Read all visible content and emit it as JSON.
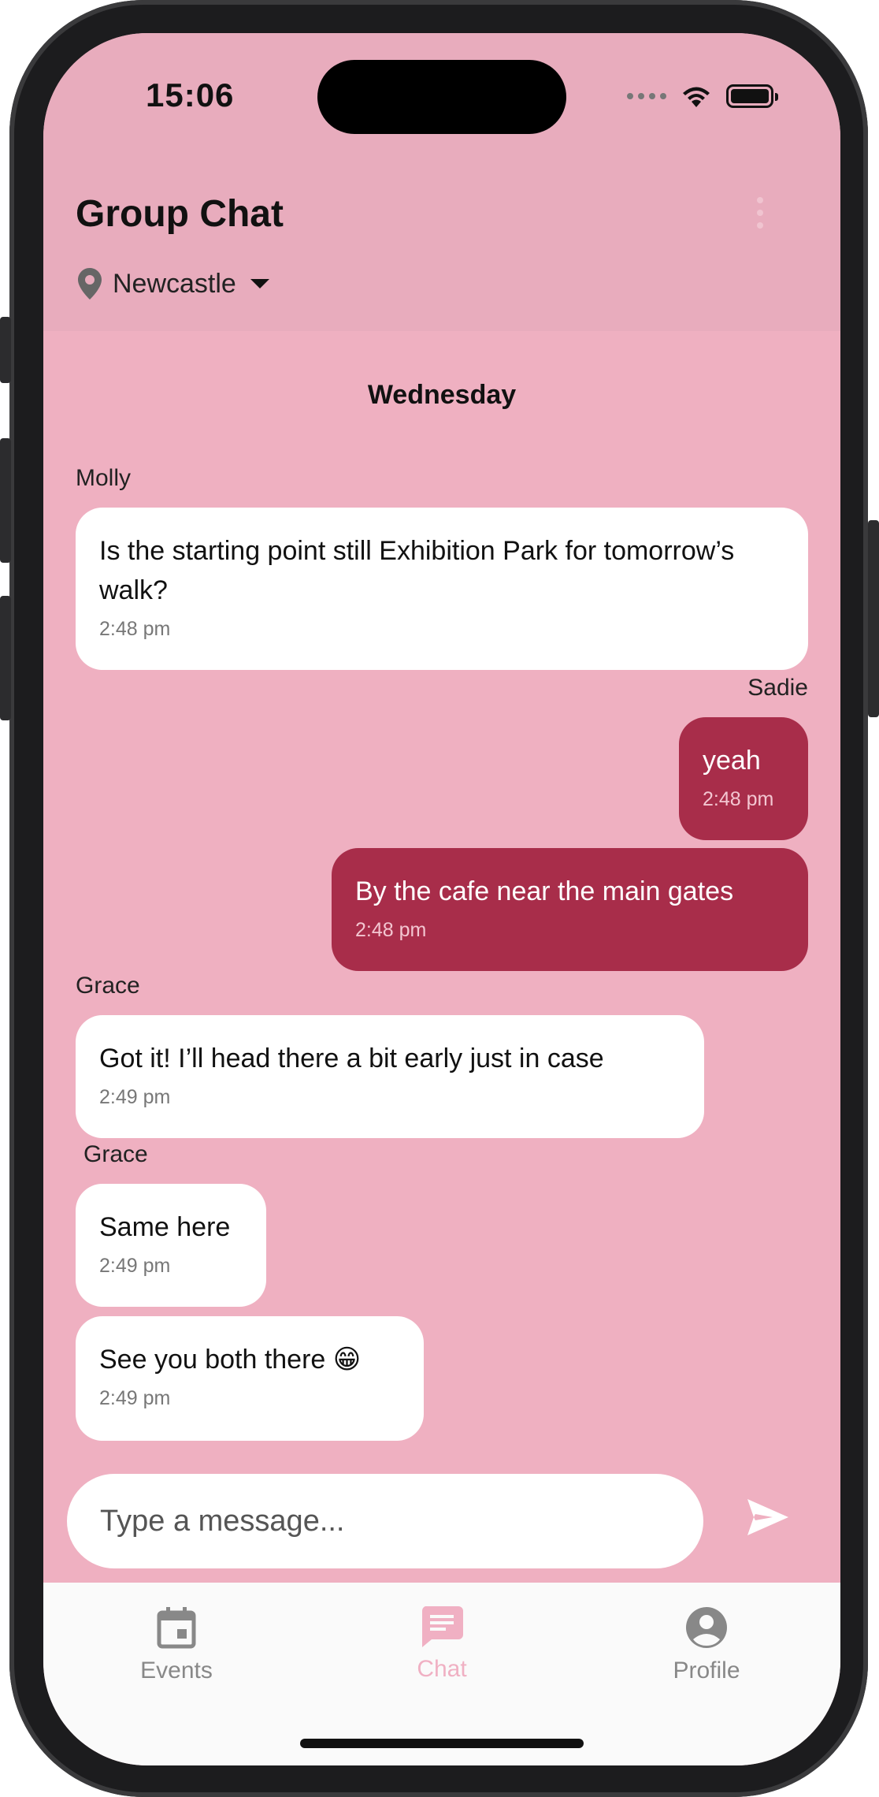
{
  "status_bar": {
    "time": "15:06"
  },
  "header": {
    "title": "Group Chat",
    "location": "Newcastle"
  },
  "chat": {
    "day_label": "Wednesday",
    "messages": [
      {
        "sender": "Molly",
        "text": "Is the starting point still Exhibition Park for tomorrow’s walk?",
        "time": "2:48 pm",
        "direction": "incoming"
      },
      {
        "sender": "Sadie",
        "text": "yeah",
        "time": "2:48 pm",
        "direction": "outgoing"
      },
      {
        "sender": "",
        "text": "By the cafe near the main gates",
        "time": "2:48 pm",
        "direction": "outgoing"
      },
      {
        "sender": "Grace",
        "text": "Got it! I’ll head there a bit early just in case",
        "time": "2:49 pm",
        "direction": "incoming"
      },
      {
        "sender": "Grace",
        "text": "Same here",
        "time": "2:49 pm",
        "direction": "incoming"
      },
      {
        "sender": "",
        "text": "See you both there 😁",
        "time": "2:49 pm",
        "direction": "incoming"
      }
    ]
  },
  "composer": {
    "placeholder": "Type a message..."
  },
  "tabs": [
    {
      "label": "Events",
      "icon": "calendar-icon",
      "active": false
    },
    {
      "label": "Chat",
      "icon": "chat-icon",
      "active": true
    },
    {
      "label": "Profile",
      "icon": "profile-icon",
      "active": false
    }
  ],
  "colors": {
    "header_bg": "#e8acbd",
    "chat_bg": "#efb0c1",
    "outgoing_bubble": "#a82d4a",
    "incoming_bubble": "#ffffff",
    "active_tab": "#f0b0c3",
    "inactive_tab": "#888888"
  }
}
